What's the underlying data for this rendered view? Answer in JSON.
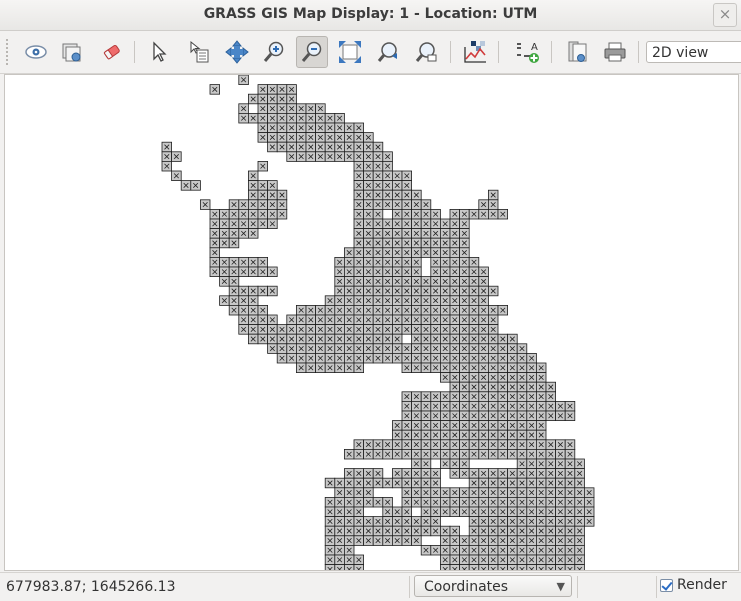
{
  "window": {
    "title": "GRASS GIS Map Display: 1 - Location: UTM",
    "close_symbol": "×"
  },
  "toolbar": {
    "tools": [
      {
        "name": "display-map-icon"
      },
      {
        "name": "render-map-icon"
      },
      {
        "name": "erase-display-icon"
      },
      {
        "name": "pointer-icon"
      },
      {
        "name": "query-icon"
      },
      {
        "name": "pan-icon"
      },
      {
        "name": "zoom-in-icon"
      },
      {
        "name": "zoom-out-icon",
        "active": true
      },
      {
        "name": "zoom-extent-icon"
      },
      {
        "name": "zoom-back-icon"
      },
      {
        "name": "zoom-menu-icon"
      },
      {
        "name": "analyze-icon"
      },
      {
        "name": "overlay-icon"
      },
      {
        "name": "save-icon"
      },
      {
        "name": "print-icon"
      }
    ],
    "view_mode": "2D view"
  },
  "status": {
    "coordinates": "677983.87; 1645266.13",
    "mode_select": "Coordinates",
    "render_label": "Render",
    "render_checked": true
  }
}
